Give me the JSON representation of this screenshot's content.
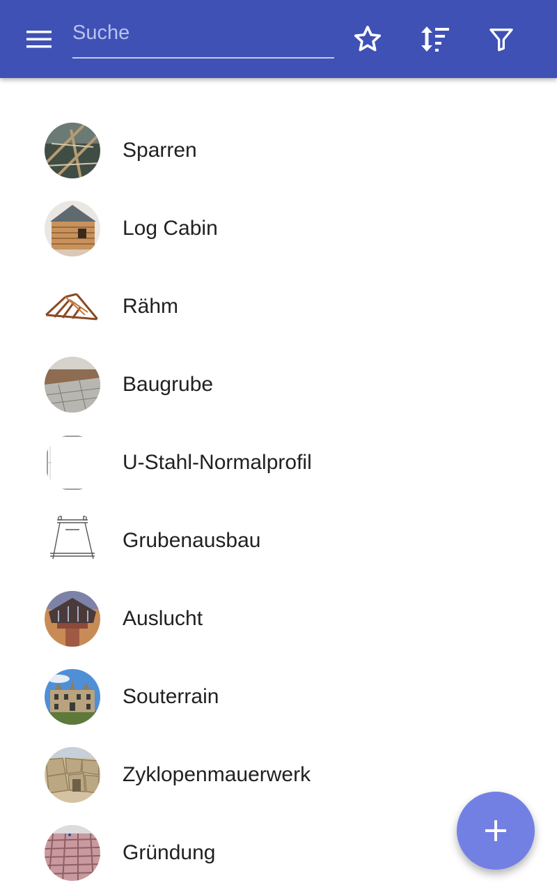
{
  "appbar": {
    "background": "#3f51b5",
    "menu_icon": "hamburger-menu-icon",
    "search": {
      "placeholder": "Suche",
      "value": ""
    },
    "actions": [
      {
        "icon": "star-outline-icon"
      },
      {
        "icon": "sort-icon"
      },
      {
        "icon": "filter-icon"
      }
    ]
  },
  "items": [
    {
      "label": "Sparren",
      "thumb": "rafters-photo"
    },
    {
      "label": "Log Cabin",
      "thumb": "log-cabin-photo"
    },
    {
      "label": "Rähm",
      "thumb": "roof-frame-drawing"
    },
    {
      "label": "Baugrube",
      "thumb": "excavation-pit-photo"
    },
    {
      "label": "U-Stahl-Normalprofil",
      "thumb": "u-steel-profile-drawing"
    },
    {
      "label": "Grubenausbau",
      "thumb": "mine-support-sketch"
    },
    {
      "label": "Auslucht",
      "thumb": "oriel-photo"
    },
    {
      "label": "Souterrain",
      "thumb": "manor-house-photo"
    },
    {
      "label": "Zyklopenmauerwerk",
      "thumb": "cyclopean-wall-photo"
    },
    {
      "label": "Gründung",
      "thumb": "foundation-site-photo"
    }
  ],
  "fab": {
    "icon": "add-icon",
    "color": "#7380e3"
  }
}
